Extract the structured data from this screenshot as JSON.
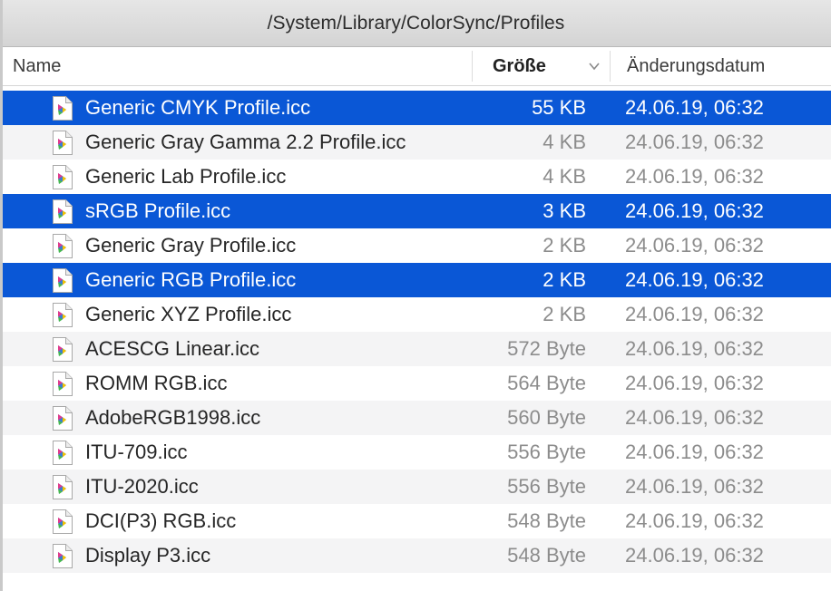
{
  "window": {
    "path_title": "/System/Library/ColorSync/Profiles"
  },
  "columns": {
    "name": "Name",
    "size": "Größe",
    "date": "Änderungsdatum",
    "sort_icon": "chevron-down-icon"
  },
  "colors": {
    "selection": "#0a57d6",
    "alt_row": "#f4f4f5",
    "secondary_text": "#8c8c8c"
  },
  "files": [
    {
      "name": "Generic CMYK Profile.icc",
      "size": "55 KB",
      "date": "24.06.19, 06:32",
      "selected": true,
      "icon": "icc-profile-icon"
    },
    {
      "name": "Generic Gray Gamma 2.2 Profile.icc",
      "size": "4 KB",
      "date": "24.06.19, 06:32",
      "selected": false,
      "icon": "icc-profile-icon"
    },
    {
      "name": "Generic Lab Profile.icc",
      "size": "4 KB",
      "date": "24.06.19, 06:32",
      "selected": false,
      "icon": "icc-profile-icon"
    },
    {
      "name": "sRGB Profile.icc",
      "size": "3 KB",
      "date": "24.06.19, 06:32",
      "selected": true,
      "icon": "icc-profile-icon"
    },
    {
      "name": "Generic Gray Profile.icc",
      "size": "2 KB",
      "date": "24.06.19, 06:32",
      "selected": false,
      "icon": "icc-profile-icon"
    },
    {
      "name": "Generic RGB Profile.icc",
      "size": "2 KB",
      "date": "24.06.19, 06:32",
      "selected": true,
      "icon": "icc-profile-icon"
    },
    {
      "name": "Generic XYZ Profile.icc",
      "size": "2 KB",
      "date": "24.06.19, 06:32",
      "selected": false,
      "icon": "icc-profile-icon"
    },
    {
      "name": "ACESCG Linear.icc",
      "size": "572 Byte",
      "date": "24.06.19, 06:32",
      "selected": false,
      "icon": "icc-profile-icon"
    },
    {
      "name": "ROMM RGB.icc",
      "size": "564 Byte",
      "date": "24.06.19, 06:32",
      "selected": false,
      "icon": "icc-profile-icon"
    },
    {
      "name": "AdobeRGB1998.icc",
      "size": "560 Byte",
      "date": "24.06.19, 06:32",
      "selected": false,
      "icon": "icc-profile-icon"
    },
    {
      "name": "ITU-709.icc",
      "size": "556 Byte",
      "date": "24.06.19, 06:32",
      "selected": false,
      "icon": "icc-profile-icon"
    },
    {
      "name": "ITU-2020.icc",
      "size": "556 Byte",
      "date": "24.06.19, 06:32",
      "selected": false,
      "icon": "icc-profile-icon"
    },
    {
      "name": "DCI(P3) RGB.icc",
      "size": "548 Byte",
      "date": "24.06.19, 06:32",
      "selected": false,
      "icon": "icc-profile-icon"
    },
    {
      "name": "Display P3.icc",
      "size": "548 Byte",
      "date": "24.06.19, 06:32",
      "selected": false,
      "icon": "icc-profile-icon"
    }
  ]
}
